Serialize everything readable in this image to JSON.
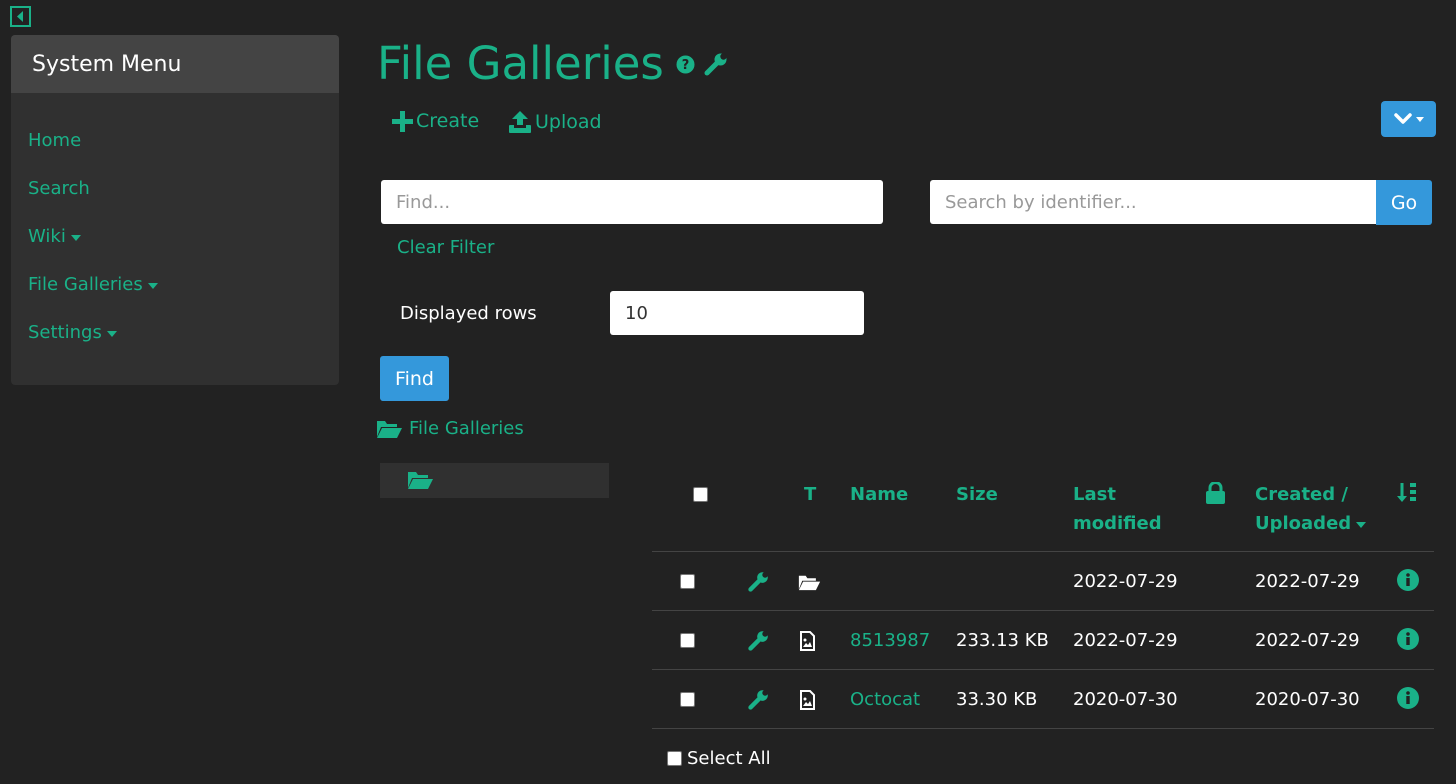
{
  "colors": {
    "accent": "#1ab188",
    "primary": "#3498db",
    "background": "#222222",
    "panel": "#303030",
    "panel_header": "#444444"
  },
  "sidebar": {
    "title": "System Menu",
    "items": [
      {
        "label": "Home",
        "has_caret": false
      },
      {
        "label": "Search",
        "has_caret": false
      },
      {
        "label": "Wiki",
        "has_caret": true
      },
      {
        "label": "File Galleries",
        "has_caret": true
      },
      {
        "label": "Settings",
        "has_caret": true
      }
    ]
  },
  "page": {
    "title": "File Galleries",
    "help_icon": "question-circle-icon",
    "admin_icon": "wrench-icon"
  },
  "toolbar": {
    "create_label": "Create",
    "upload_label": "Upload",
    "dropdown_icon": "chevron-down-icon"
  },
  "filters": {
    "find_placeholder": "Find...",
    "find_value": "",
    "identifier_placeholder": "Search by identifier...",
    "identifier_value": "",
    "go_label": "Go",
    "clear_filter_label": "Clear Filter",
    "displayed_rows_label": "Displayed rows",
    "displayed_rows_value": "10",
    "find_button_label": "Find"
  },
  "breadcrumb": {
    "label": "File Galleries",
    "icon": "folder-open-icon"
  },
  "table": {
    "headers": {
      "type": "T",
      "name": "Name",
      "size": "Size",
      "last_modified_1": "Last",
      "last_modified_2": "modified",
      "lock_icon": "lock-icon",
      "created_1": "Created /",
      "created_2": "Uploaded",
      "sort_icon": "sort-icon"
    },
    "rows": [
      {
        "type_icon": "folder-open-icon",
        "name": "",
        "size": "",
        "last_modified": "2022-07-29",
        "created": "2022-07-29"
      },
      {
        "type_icon": "file-image-icon",
        "name": "8513987",
        "size": "233.13 KB",
        "last_modified": "2022-07-29",
        "created": "2022-07-29"
      },
      {
        "type_icon": "file-image-icon",
        "name": "Octocat",
        "size": "33.30 KB",
        "last_modified": "2020-07-30",
        "created": "2020-07-30"
      }
    ],
    "select_all_label": "Select All"
  }
}
